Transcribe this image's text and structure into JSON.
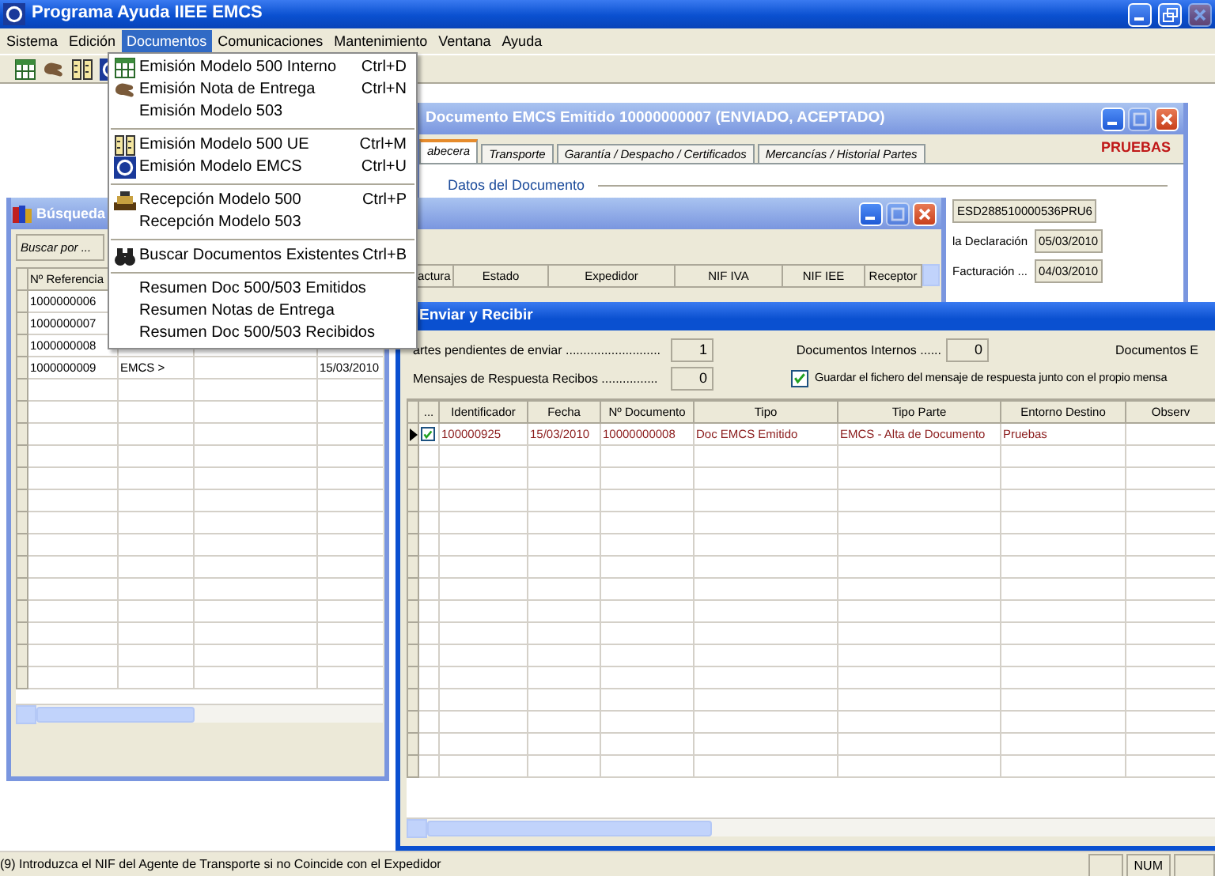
{
  "app": {
    "title": "Programa Ayuda IIEE EMCS",
    "buttons": [
      {
        "kind": "minimize",
        "disabled": false
      },
      {
        "kind": "restore",
        "disabled": false
      },
      {
        "kind": "close",
        "disabled": true
      }
    ]
  },
  "menu_bar": [
    {
      "label": "Sistema",
      "selected": false
    },
    {
      "label": "Edición",
      "selected": false
    },
    {
      "label": "Documentos",
      "selected": true
    },
    {
      "label": "Comunicaciones",
      "selected": false
    },
    {
      "label": "Mantenimiento",
      "selected": false
    },
    {
      "label": "Ventana",
      "selected": false
    },
    {
      "label": "Ayuda",
      "selected": false
    }
  ],
  "documentos_menu": [
    [
      {
        "label": "Emisión Modelo 500 Interno",
        "shortcut": "Ctrl+D"
      },
      {
        "label": "Emisión Nota de Entrega",
        "shortcut": "Ctrl+N"
      },
      {
        "label": "Emisión Modelo 503"
      }
    ],
    [
      {
        "label": "Emisión Modelo 500 UE",
        "shortcut": "Ctrl+M"
      },
      {
        "label": "Emisión Modelo EMCS",
        "shortcut": "Ctrl+U"
      }
    ],
    [
      {
        "label": "Recepción Modelo 500",
        "shortcut": "Ctrl+P"
      },
      {
        "label": "Recepción Modelo 503"
      }
    ],
    [
      {
        "label": "Buscar Documentos Existentes",
        "shortcut": "Ctrl+B"
      }
    ],
    [
      {
        "label": "Resumen Doc 500/503 Emitidos"
      },
      {
        "label": "Resumen Notas de Entrega"
      },
      {
        "label": "Resumen Doc 500/503 Recibidos"
      }
    ]
  ],
  "documento_window": {
    "title": "Documento EMCS Emitido 10000000007 (ENVIADO, ACEPTADO)",
    "buttons": [
      {
        "kind": "minimize",
        "disabled": false
      },
      {
        "kind": "maximize",
        "disabled": true
      },
      {
        "kind": "close",
        "disabled": false
      }
    ],
    "tabs": [
      {
        "label": "abecera",
        "selected": true
      },
      {
        "label": "Transporte",
        "selected": false
      },
      {
        "label": "Garantía / Despacho / Certificados",
        "selected": false
      },
      {
        "label": "Mercancías / Historial Partes",
        "selected": false
      }
    ],
    "environment": "PRUEBAS",
    "section": "Datos del Documento",
    "fields": [
      {
        "value": "ESD288510000536PRU6"
      },
      {
        "label": "la Declaración",
        "value": "05/03/2010"
      },
      {
        "label": "Facturación ...",
        "value": "04/03/2010"
      }
    ]
  },
  "list_window": {
    "buttons": [
      {
        "kind": "minimize",
        "disabled": false
      },
      {
        "kind": "maximize",
        "disabled": true
      },
      {
        "kind": "close",
        "disabled": false
      }
    ],
    "columns": [
      "actura",
      "Estado",
      "Expedidor",
      "NIF IVA",
      "NIF IEE",
      "Receptor"
    ]
  },
  "busqueda_window": {
    "title": "Búsqueda",
    "search_button": "Buscar por ...",
    "columns": [
      "Nº Referencia"
    ],
    "rows": [
      {
        "reference": "1000000006"
      },
      {
        "reference": "1000000007"
      },
      {
        "reference": "1000000008"
      },
      {
        "reference": "1000000009",
        "column_2": "EMCS >",
        "column_4": "15/03/2010"
      }
    ]
  },
  "enviar_window": {
    "title": "Enviar y Recibir",
    "counters": [
      {
        "label": "artes pendientes de enviar ...........................",
        "value": "1"
      },
      {
        "label": "Documentos Internos ......",
        "value": "0"
      },
      {
        "label": "Documentos E"
      },
      {
        "label": "Mensajes de Respuesta Recibos ................",
        "value": "0"
      }
    ],
    "save_option": {
      "label": "Guardar el fichero del mensaje de respuesta junto con el propio mensa",
      "checked": true
    },
    "select_column_header": "...",
    "columns": [
      "Identificador",
      "Fecha",
      "Nº Documento",
      "Tipo",
      "Tipo Parte",
      "Entorno Destino",
      "Observ"
    ],
    "rows": [
      {
        "current": true,
        "checked": true,
        "cells": [
          "100000925",
          "15/03/2010",
          "10000000008",
          "Doc EMCS Emitido",
          "EMCS - Alta de Documento",
          "Pruebas"
        ]
      }
    ]
  },
  "status_bar": {
    "message": "(9) Introduzca el NIF del Agente de Transporte si no Coincide con el Expedidor",
    "panels": [
      "NUM"
    ]
  }
}
